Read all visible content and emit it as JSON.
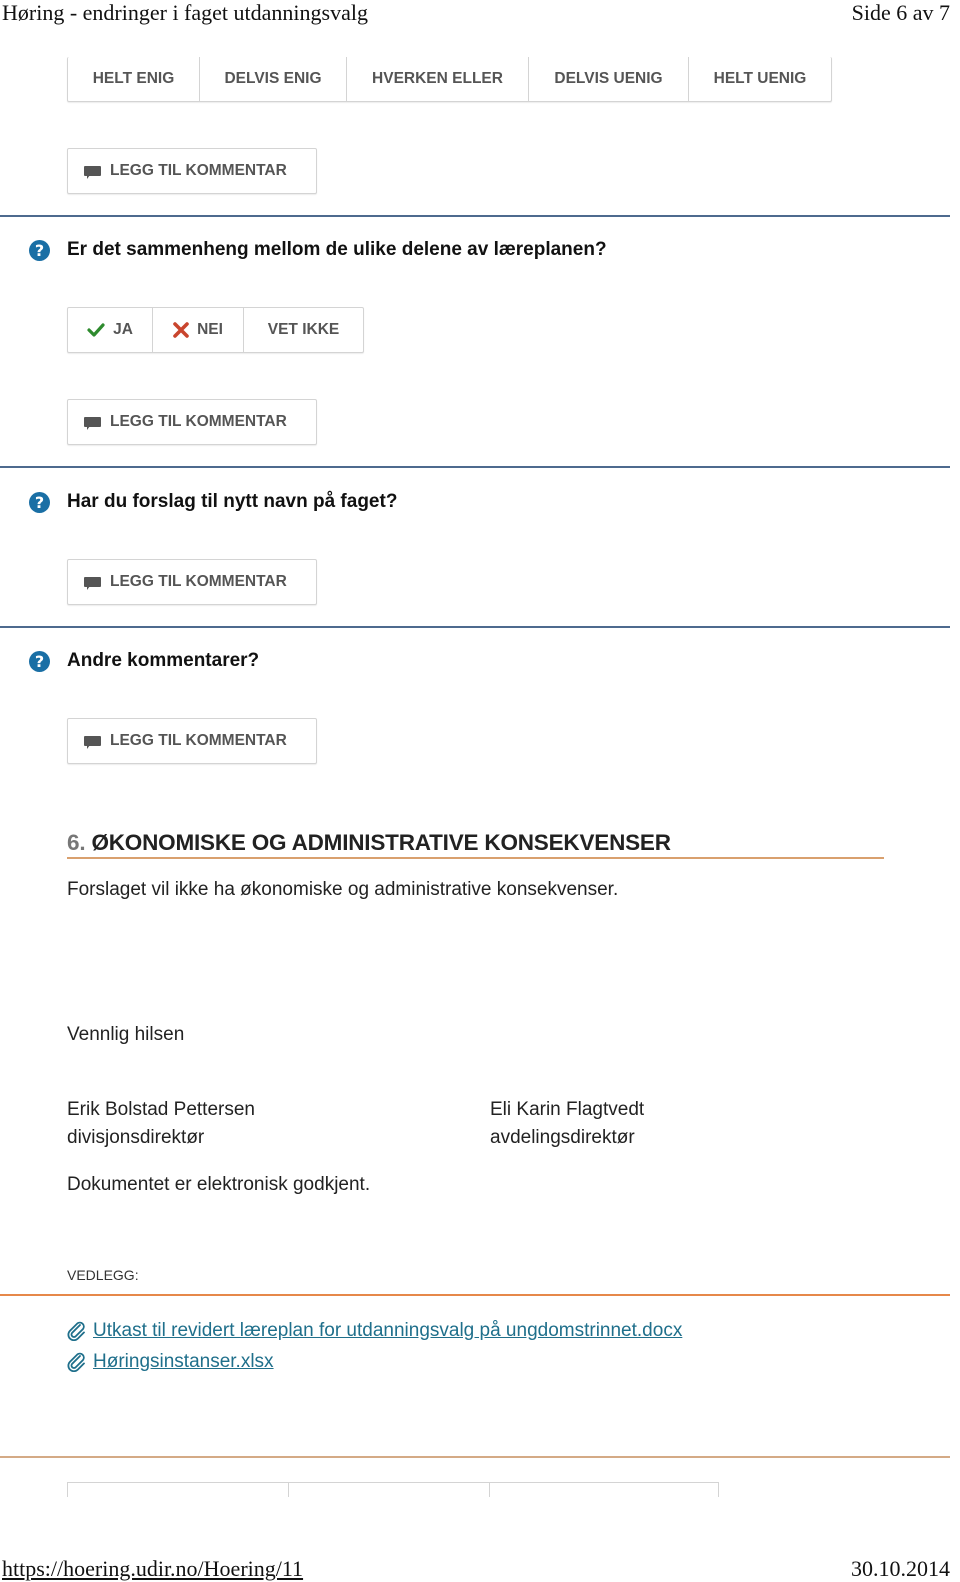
{
  "print_header": {
    "title": "Høring - endringer i faget utdanningsvalg",
    "page": "Side 6 av 7"
  },
  "likert": {
    "options": [
      "HELT ENIG",
      "DELVIS ENIG",
      "HVERKEN ELLER",
      "DELVIS UENIG",
      "HELT UENIG"
    ]
  },
  "comment_button_label": "LEGG TIL KOMMENTAR",
  "questions": [
    {
      "text": "Er det sammenheng mellom de ulike delene av læreplanen?",
      "answers": [
        {
          "label": "JA",
          "icon": "check-icon",
          "color": "#2e8b2e"
        },
        {
          "label": "NEI",
          "icon": "cross-icon",
          "color": "#c9452e"
        },
        {
          "label": "VET IKKE"
        }
      ]
    },
    {
      "text": "Har du forslag til nytt navn på faget?"
    },
    {
      "text": "Andre kommentarer?"
    }
  ],
  "section": {
    "number": "6.",
    "title": "ØKONOMISKE OG ADMINISTRATIVE KONSEKVENSER",
    "body": "Forslaget vil ikke ha økonomiske og administrative konsekvenser."
  },
  "closing": {
    "greeting": "Vennlig hilsen",
    "signers": [
      {
        "name": "Erik Bolstad Pettersen",
        "role": "divisjonsdirektør"
      },
      {
        "name": "Eli Karin Flagtvedt",
        "role": "avdelingsdirektør"
      }
    ],
    "approval_note": "Dokumentet er elektronisk godkjent."
  },
  "attachments": {
    "label": "VEDLEGG:",
    "files": [
      "Utkast til revidert læreplan for utdanningsvalg på ungdomstrinnet.docx",
      "Høringsinstanser.xlsx"
    ]
  },
  "print_footer": {
    "url": "https://hoering.udir.no/Hoering/11",
    "date": "30.10.2014"
  },
  "colors": {
    "question_icon": "#1a6fa5",
    "rule_blue": "#4e6a8e",
    "rule_orange": "#d9a06e",
    "link": "#1f6f8b"
  }
}
